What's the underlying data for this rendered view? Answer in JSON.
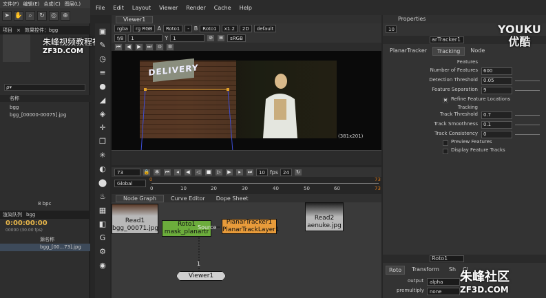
{
  "ae": {
    "menu": [
      "文件(F)",
      "编辑(E)",
      "合成(C)",
      "图层(L)"
    ],
    "project_label": "项目",
    "effects_label": "效果控件：bgg",
    "search_placeholder": "ρ▾",
    "col_name": "名称",
    "items": [
      "bgg",
      "bgg_[00000-00075].jpg"
    ],
    "render_queue": "渲染队列",
    "comp_tab": "bgg",
    "timecode": "0:00:00:00",
    "fps_note": "00000 (30.00 fps)",
    "source_name": "源名称",
    "layer_name": "bgg_[00...73].jpg",
    "bpc": "8 bpc"
  },
  "overlay": {
    "site_title": "朱峰视频教程社区",
    "site_url": "ZF3D.COM",
    "youku_a": "YOUKU",
    "youku_b": "优酷",
    "bottom_a": "朱峰社区",
    "bottom_b": "ZF3D.COM"
  },
  "nuke": {
    "menu": [
      "File",
      "Edit",
      "Layout",
      "Viewer",
      "Render",
      "Cache",
      "Help"
    ],
    "viewer_tab": "Viewer1",
    "row1": [
      "rgba",
      "rg RGB",
      "A",
      "Roto1",
      "-",
      "B",
      "Roto1",
      "x1.2",
      "2D",
      "default"
    ],
    "row2": [
      "f/8",
      "1",
      "Y",
      "1",
      "sRGB"
    ],
    "res_label": "(381x201)",
    "sign_text": "DELIVERY",
    "frame": "73",
    "step": "10",
    "fps_label": "fps",
    "fps_value": "24",
    "range_mode": "Global",
    "ticks": [
      "0",
      "10",
      "20",
      "30",
      "40",
      "50",
      "60",
      "73"
    ],
    "range_start": "0",
    "range_end": "73",
    "ng_tabs": [
      "Node Graph",
      "Curve Editor",
      "Dope Sheet"
    ],
    "nodes": {
      "read1": "Read1",
      "read1_file": "bgg_00071.jpg",
      "roto1": "Roto1",
      "roto1_sub": "mask_planartr",
      "source": "Source",
      "planar": "PlanarTracker1",
      "planar_sub": "PlanarTrackLayer1",
      "read2": "Read2",
      "read2_file": "aenuke.jpg",
      "viewer": "Viewer1",
      "pipe": "1"
    }
  },
  "props": {
    "title": "Properties",
    "max_panels": "10",
    "node_name": "arTracker1",
    "tabs": [
      "PlanarTracker",
      "Tracking",
      "Node"
    ],
    "features_head": "Features",
    "rows": [
      {
        "label": "Number of Features",
        "value": "600"
      },
      {
        "label": "Detection Threshold",
        "value": "0.05"
      },
      {
        "label": "Feature Separation",
        "value": "9"
      }
    ],
    "refine_label": "Refine Feature Locations",
    "tracking_head": "Tracking",
    "track_rows": [
      {
        "label": "Track Threshold",
        "value": "0.7"
      },
      {
        "label": "Track Smoothness",
        "value": "0.1"
      },
      {
        "label": "Track Consistency",
        "value": "0"
      }
    ],
    "preview_label": "Preview Features",
    "display_label": "Display Feature Tracks",
    "roto_node": "Roto1",
    "roto_tabs": [
      "Roto",
      "Transform",
      "Sh",
      "Cl"
    ],
    "output_label": "output",
    "output_value": "alpha",
    "premult_label": "premultiply",
    "premult_value": "none",
    "slider_ticks": [
      "0.1",
      "0.2",
      "0.3",
      "0.5"
    ]
  }
}
